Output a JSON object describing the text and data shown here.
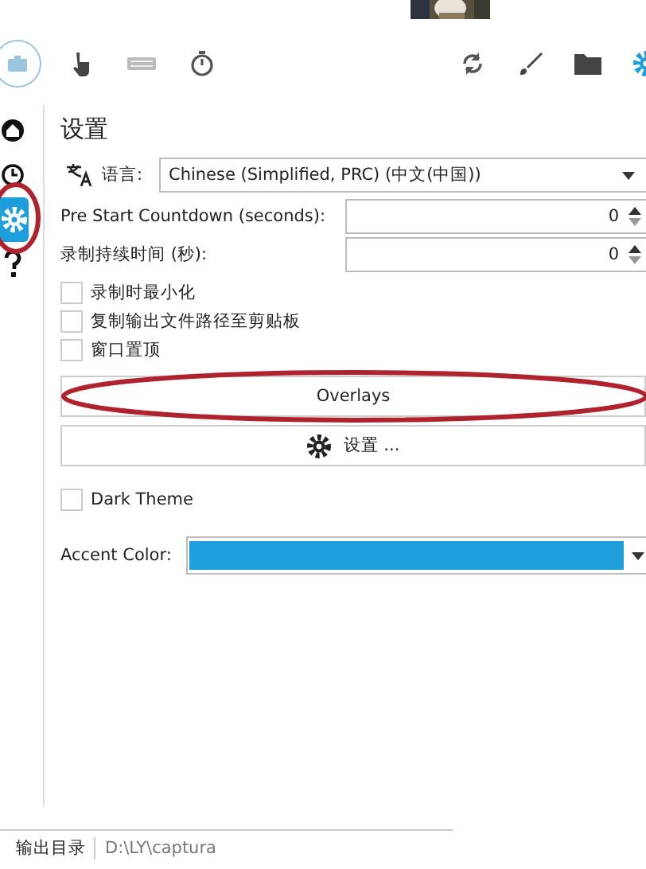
{
  "toolbar": {
    "tabs": [
      {
        "selected": true
      },
      {
        "selected": false
      },
      {
        "selected": false
      },
      {
        "selected": false
      }
    ]
  },
  "sidebar": {
    "items": [
      {
        "selected": false
      },
      {
        "selected": false
      },
      {
        "selected": true
      },
      {
        "selected": false
      }
    ]
  },
  "settings": {
    "title": "设置",
    "language": {
      "label": "语言:",
      "value": "Chinese (Simplified, PRC) (中文(中国))"
    },
    "numbers": [
      {
        "label": "Pre Start Countdown (seconds):",
        "value": "0"
      },
      {
        "label": "录制持续时间 (秒):",
        "value": "0"
      }
    ],
    "checkboxes": [
      {
        "label": "录制时最小化",
        "checked": false
      },
      {
        "label": "复制输出文件路径至剪贴板",
        "checked": false
      },
      {
        "label": "窗口置顶",
        "checked": false
      }
    ],
    "overlays_button": "Overlays",
    "settings_button": "设置 ...",
    "dark_theme": {
      "label": "Dark Theme",
      "checked": false
    },
    "accent": {
      "label": "Accent Color:",
      "color": "#1e9fdc"
    }
  },
  "status_bar": {
    "label": "输出目录",
    "path": "D:\\LY\\captura"
  }
}
